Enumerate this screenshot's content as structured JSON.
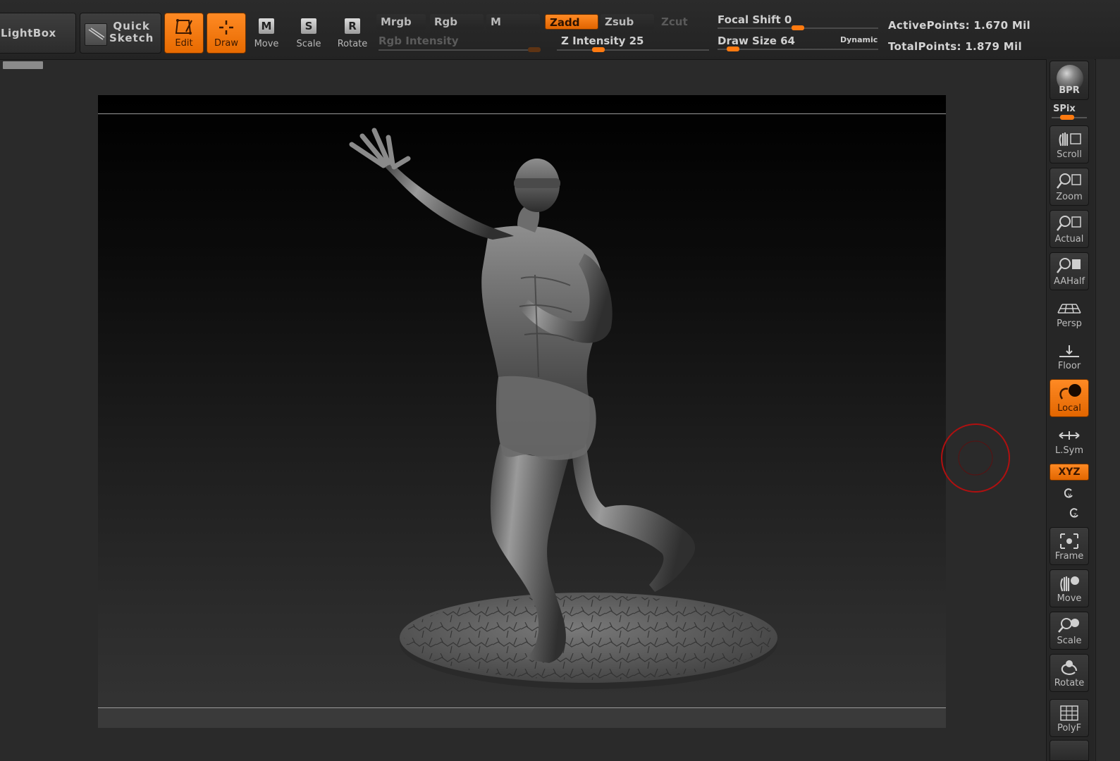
{
  "shelf": {
    "lightbox_label": "LightBox",
    "quick_sketch_label": "Quick\nSketch",
    "edit_label": "Edit",
    "draw_label": "Draw",
    "move_label": "Move",
    "scale_label": "Scale",
    "rotate_label": "Rotate",
    "move_letter": "M",
    "scale_letter": "S",
    "rotate_letter": "R",
    "mrgb_label": "Mrgb",
    "rgb_label": "Rgb",
    "m_label": "M",
    "zadd_label": "Zadd",
    "zsub_label": "Zsub",
    "zcut_label": "Zcut",
    "rgb_intensity_label": "Rgb  Intensity",
    "z_intensity_label": "Z  Intensity  25",
    "focal_shift_label": "Focal  Shift  0",
    "draw_size_label": "Draw  Size  64",
    "dynamic_label": "Dynamic",
    "active_points_label": "ActivePoints:  1.670  Mil",
    "total_points_label": "TotalPoints:  1.879  Mil"
  },
  "sliders": {
    "z_intensity": 25,
    "focal_shift": 0,
    "draw_size": 64
  },
  "right_tray": {
    "bpr_label": "BPR",
    "spix_label": "SPix",
    "scroll_label": "Scroll",
    "zoom_label": "Zoom",
    "actual_label": "Actual",
    "aahalf_label": "AAHalf",
    "persp_label": "Persp",
    "floor_label": "Floor",
    "local_label": "Local",
    "lsym_label": "L.Sym",
    "xyz_label": "XYZ",
    "frame_label": "Frame",
    "move_label": "Move",
    "scale_label": "Scale",
    "rotate_label": "Rotate",
    "polyf_label": "PolyF"
  },
  "colors": {
    "accent": "#ff7a10",
    "active_button": "#f07800",
    "brush_cursor": "#b01010",
    "background": "#2a2a2a"
  },
  "icons": {
    "edit": "edit-icon",
    "draw": "draw-crosshair-icon",
    "scroll": "hand-icon",
    "zoom": "magnifier-icon",
    "local": "local-pivot-icon",
    "frame": "frame-icon",
    "polyf": "grid-icon"
  }
}
